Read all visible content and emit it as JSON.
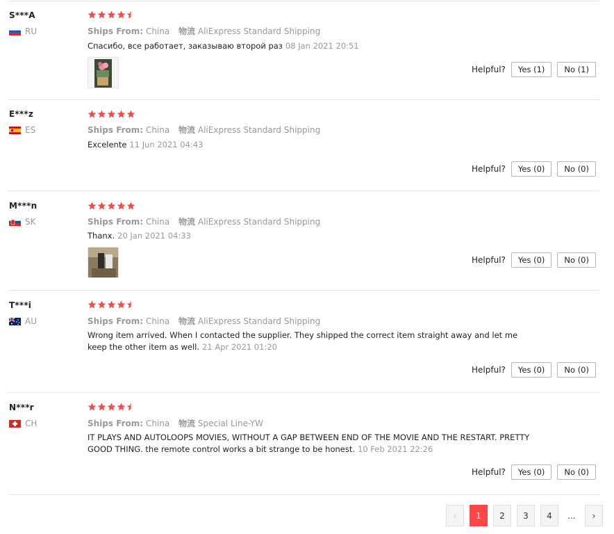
{
  "colors": {
    "accent": "#ff4747",
    "star": "#f44b4b",
    "muted": "#999999"
  },
  "labels": {
    "ships_from": "Ships From:",
    "logistics": "物流",
    "helpful": "Helpful?"
  },
  "reviews": [
    {
      "name": "S***A",
      "country": "RU",
      "rating": 4.5,
      "ships_from": "China",
      "shipping": "AliExpress Standard Shipping",
      "text": "Спасибо, все работает, заказываю второй раз",
      "date": "08 Jan 2021 20:51",
      "has_image": true,
      "yes": "Yes (1)",
      "no": "No (1)"
    },
    {
      "name": "E***z",
      "country": "ES",
      "rating": 5,
      "ships_from": "China",
      "shipping": "AliExpress Standard Shipping",
      "text": "Excelente",
      "date": "11 Jun 2021 04:43",
      "has_image": false,
      "yes": "Yes (0)",
      "no": "No (0)"
    },
    {
      "name": "M***n",
      "country": "SK",
      "rating": 5,
      "ships_from": "China",
      "shipping": "AliExpress Standard Shipping",
      "text": "Thanx.",
      "date": "20 Jan 2021 04:33",
      "has_image": true,
      "yes": "Yes (0)",
      "no": "No (0)"
    },
    {
      "name": "T***i",
      "country": "AU",
      "rating": 4.5,
      "ships_from": "China",
      "shipping": "AliExpress Standard Shipping",
      "text": "Wrong item arrived. When I contacted the supplier. They shipped the correct item straight away and let me keep the other item as well.",
      "date": "21 Apr 2021 01:20",
      "has_image": false,
      "yes": "Yes (0)",
      "no": "No (0)"
    },
    {
      "name": "N***r",
      "country": "CH",
      "rating": 4.5,
      "ships_from": "China",
      "shipping": "Special Line-YW",
      "text": "IT PLAYS AND AUTOLOOPS MOVIES, WITHOUT A GAP BETWEEN END OF THE MOVIE AND THE RESTART. PRETTY GOOD THING. the remote control works a bit strange to be honest.",
      "date": "10 Feb 2021 22:26",
      "has_image": false,
      "yes": "Yes (0)",
      "no": "No (0)"
    }
  ],
  "pagination": {
    "prev_icon": "chevron-left-icon",
    "pages": [
      "1",
      "2",
      "3",
      "4"
    ],
    "current": "1",
    "ellipsis": "...",
    "next_icon": "chevron-right-icon"
  }
}
